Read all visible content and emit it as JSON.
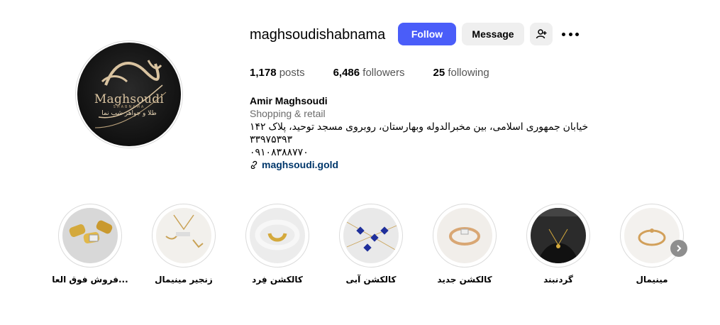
{
  "profile": {
    "username": "maghsoudishabnama",
    "avatar": {
      "brand": "Maghsoudi",
      "brand_sub": "SHABNAMA",
      "brand_fa": "طلا و جواهر شب نما"
    },
    "buttons": {
      "follow": "Follow",
      "message": "Message"
    },
    "stats": {
      "posts_count": "1,178",
      "posts_label": "posts",
      "followers_count": "6,486",
      "followers_label": "followers",
      "following_count": "25",
      "following_label": "following"
    },
    "bio": {
      "name": "Amir Maghsoudi",
      "category": "Shopping & retail",
      "address": "خیابان جمهوری اسلامی، بین مخبرالدوله وبهارستان، روبروی مسجد توحید، پلاک ۱۴۲",
      "phone1": "۳۳۹۷۵۳۹۳",
      "phone2": "۰۹۱۰۸۳۸۸۷۷۰",
      "link": "maghsoudi.gold"
    }
  },
  "highlights": [
    {
      "label": "فروش فوق العا..."
    },
    {
      "label": "زنجیر مینیمال"
    },
    {
      "label": "کالکشن فِرد"
    },
    {
      "label": "کالکشن آبی"
    },
    {
      "label": "کالکشن جدید"
    },
    {
      "label": "گردنبند"
    },
    {
      "label": "مینیمال"
    }
  ],
  "colors": {
    "follow_button": "#4a5df9",
    "secondary_button": "#efefef",
    "link": "#00376b"
  }
}
